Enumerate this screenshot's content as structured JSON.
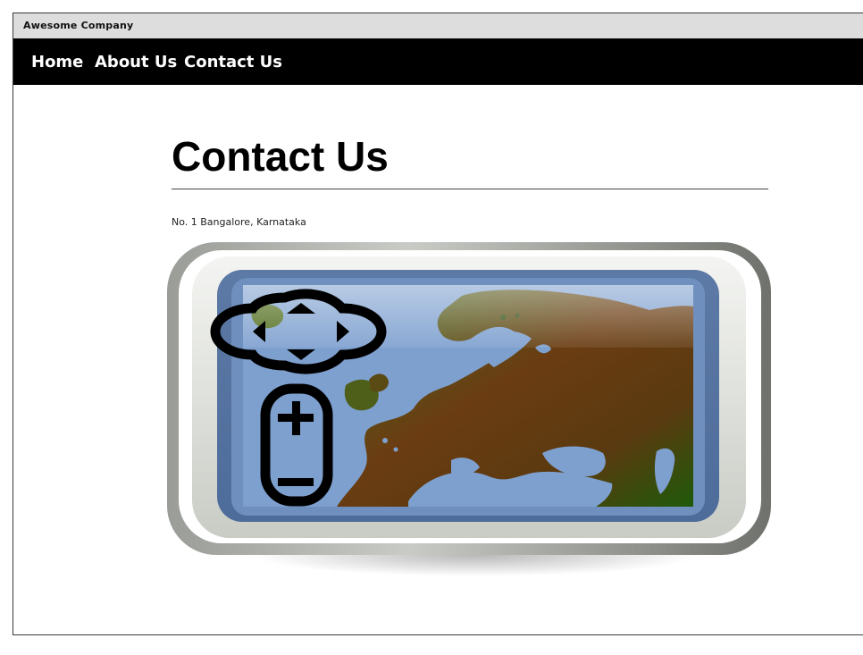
{
  "window": {
    "title": "Awesome Company"
  },
  "nav": {
    "items": [
      "Home",
      "About Us",
      "Contact Us"
    ]
  },
  "page": {
    "heading": "Contact Us",
    "address": "No. 1 Bangalore, Karnataka"
  },
  "image": {
    "icon_names": [
      "map-tablet-icon",
      "dpad-icon",
      "battery-icon"
    ],
    "colors": {
      "screen": "#7ea0cf",
      "land_green": "#3e6b1e",
      "land_brown": "#6e3b12",
      "bezel": "#d8dbd6"
    }
  }
}
